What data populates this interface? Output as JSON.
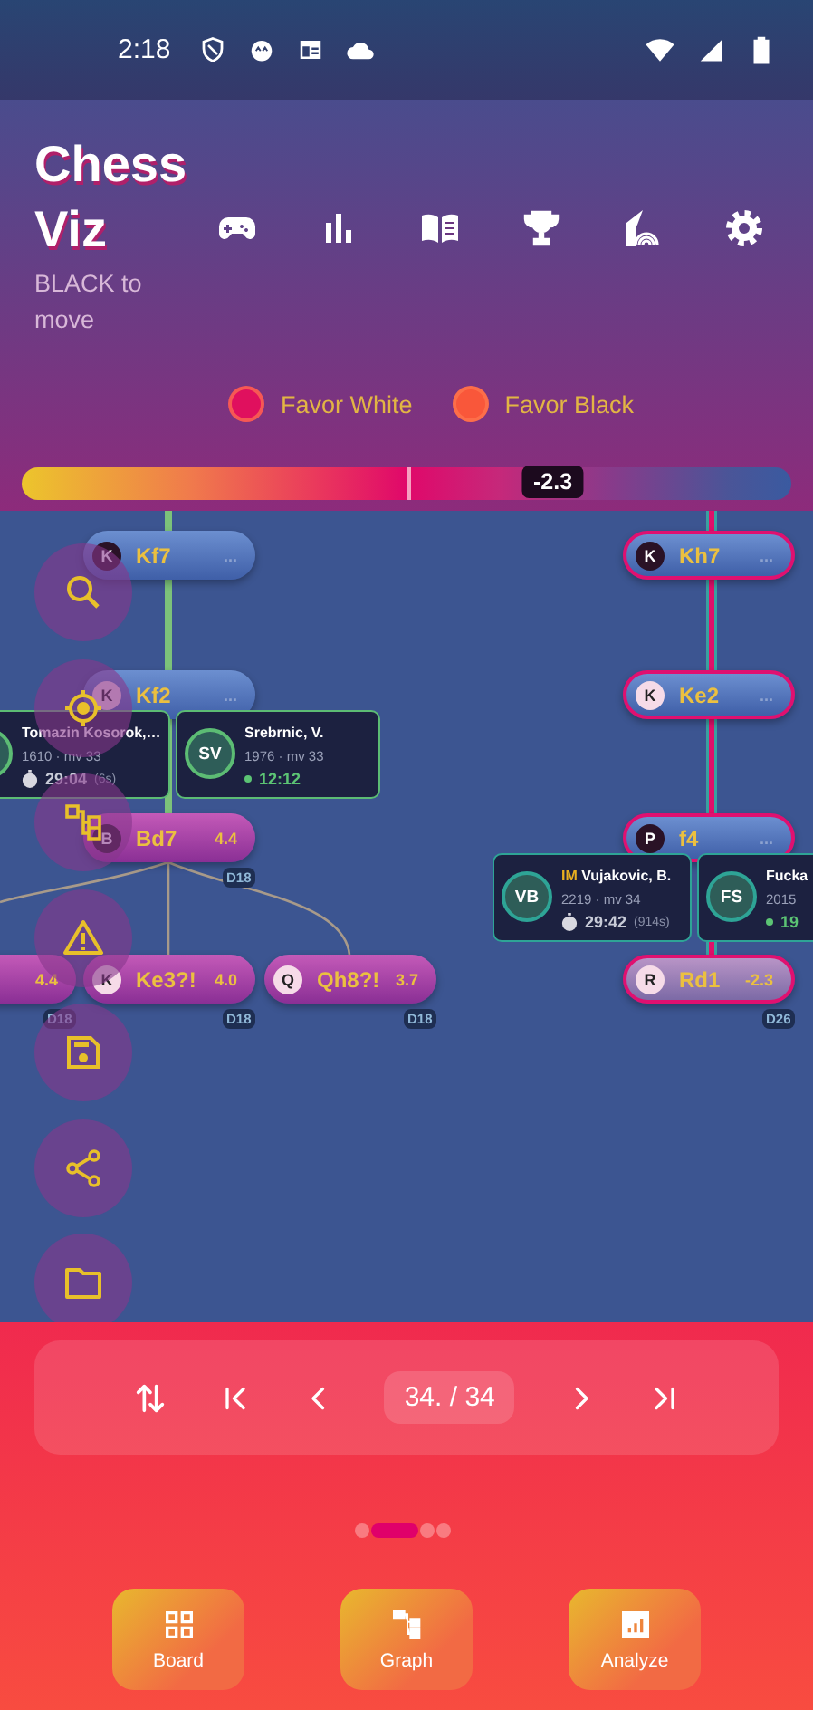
{
  "status_bar": {
    "time": "2:18"
  },
  "header": {
    "title": "Chess Viz",
    "subtitle": "BLACK to move"
  },
  "legend": [
    {
      "label": "Favor White",
      "color": "#e0105e"
    },
    {
      "label": "Favor Black",
      "color": "#f9573a"
    }
  ],
  "eval_bar": {
    "level": 0.69,
    "reading": "-2.3"
  },
  "graph": {
    "nodes": [
      {
        "move": "Kf7",
        "piece": "K",
        "dark_piece": true,
        "eval": "...",
        "kind": "position",
        "highlighted": false
      },
      {
        "move": "Kf2",
        "piece": "K",
        "dark_piece": false,
        "eval": "...",
        "kind": "position",
        "highlighted": false
      },
      {
        "move": "Bd7",
        "piece": "B",
        "dark_piece": true,
        "eval": "4.4",
        "depth": "D18",
        "kind": "variation",
        "highlighted": false
      },
      {
        "eval": "4.4",
        "depth": "D18",
        "kind": "variation",
        "highlighted": false
      },
      {
        "move": "Ke3?!",
        "piece": "K",
        "dark_piece": false,
        "eval": "4.0",
        "depth": "D18",
        "kind": "variation",
        "highlighted": false
      },
      {
        "move": "Qh8?!",
        "piece": "Q",
        "dark_piece": false,
        "eval": "3.7",
        "depth": "D18",
        "kind": "variation",
        "highlighted": false
      },
      {
        "move": "Kh7",
        "piece": "K",
        "dark_piece": true,
        "eval": "...",
        "kind": "position",
        "highlighted": true
      },
      {
        "move": "Ke2",
        "piece": "K",
        "dark_piece": false,
        "eval": "...",
        "kind": "position",
        "highlighted": true
      },
      {
        "move": "f4",
        "piece": "P",
        "dark_piece": true,
        "eval": "...",
        "kind": "position",
        "highlighted": true
      },
      {
        "move": "Rd1",
        "piece": "R",
        "dark_piece": false,
        "eval": "-2.3",
        "depth": "D26",
        "kind": "current",
        "highlighted": true
      }
    ],
    "player_cards": [
      {
        "name": "Tomazin Kosorok,…",
        "rating": "1610 · mv 33",
        "clock": "29:04",
        "clock_note": "(6s)",
        "clock_running": false
      },
      {
        "initials": "SV",
        "name": "Srebrnic, V.",
        "rating": "1976 · mv 33",
        "clock": "12:12",
        "clock_running": true
      },
      {
        "initials": "VB",
        "title": "IM",
        "name": "Vujakovic, B.",
        "rating": "2219 · mv 34",
        "clock": "29:42",
        "clock_note": "(914s)",
        "clock_running": false
      },
      {
        "initials": "FS",
        "name": "Fucka",
        "rating": "2015",
        "clock": "19",
        "clock_running": true
      }
    ]
  },
  "navigation": {
    "position": "34. / 34"
  },
  "page_dots": [
    {
      "selected": false
    },
    {
      "selected": true
    },
    {
      "selected": false
    },
    {
      "selected": false
    }
  ],
  "bottom_buttons": [
    {
      "label": "Board"
    },
    {
      "label": "Graph"
    },
    {
      "label": "Analyze"
    }
  ]
}
